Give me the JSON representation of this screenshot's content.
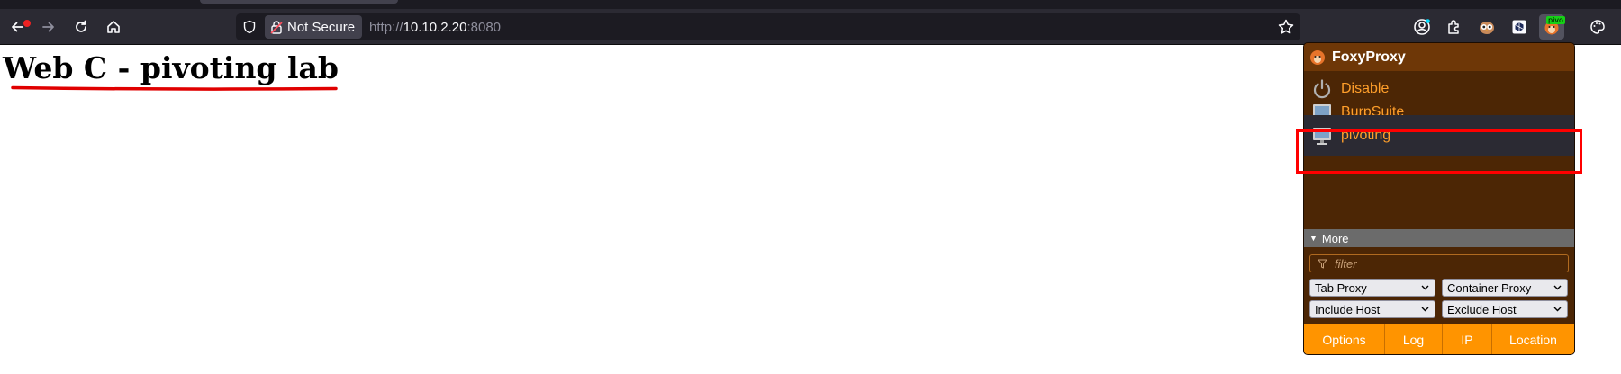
{
  "browser": {
    "security_label": "Not Secure",
    "url_prefix": "http://",
    "url_host": "10.10.2.20",
    "url_port": ":8080",
    "active_extension_badge": "pivo"
  },
  "page": {
    "title": "Web C - pivoting lab",
    "underline_color": "#e00000"
  },
  "foxyproxy": {
    "title": "FoxyProxy",
    "items": [
      {
        "label": "Disable",
        "icon": "power-icon"
      },
      {
        "label": "BurpSuite",
        "icon": "monitor-icon"
      },
      {
        "label": "pivoting",
        "icon": "monitor-icon",
        "selected": true
      }
    ],
    "more_label": "More",
    "filter_placeholder": "filter",
    "selects": {
      "tab_proxy": "Tab Proxy",
      "container_proxy": "Container Proxy",
      "include_host": "Include Host",
      "exclude_host": "Exclude Host"
    },
    "footer": {
      "options": "Options",
      "log": "Log",
      "ip": "IP",
      "location": "Location"
    },
    "colors": {
      "background": "#4c2605",
      "header": "#6e3707",
      "accent_text": "#ff9f2b",
      "footer": "#ff9400",
      "highlight": "#ff0000"
    }
  }
}
